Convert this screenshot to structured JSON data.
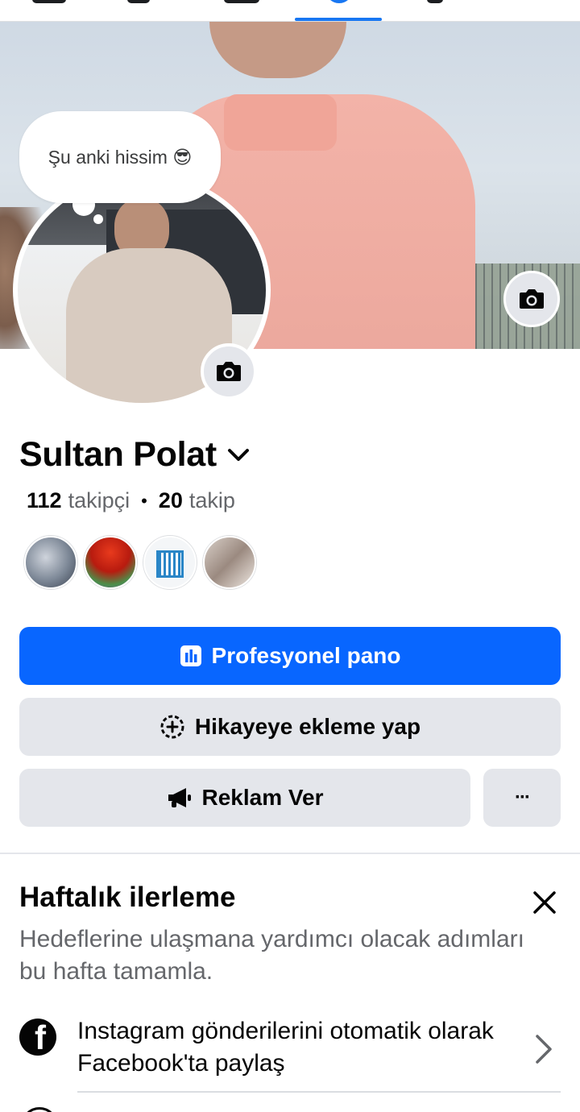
{
  "profile": {
    "note": "Şu anki hissim 😎",
    "name": "Sultan Polat",
    "followers_count": "112",
    "followers_label": "takipçi",
    "following_count": "20",
    "following_label": "takip"
  },
  "actions": {
    "dashboard": "Profesyonel pano",
    "add_story": "Hikayeye ekleme yap",
    "advertise": "Reklam Ver",
    "more": "···"
  },
  "weekly_progress": {
    "title": "Haftalık ilerleme",
    "description": "Hedeflerine ulaşmana yardımcı olacak adımları bu hafta tamamla.",
    "tasks": [
      {
        "icon": "facebook-icon",
        "label": "Instagram gönderilerini otomatik olarak Facebook'ta paylaş"
      }
    ]
  },
  "colors": {
    "primary": "#0866ff",
    "secondary_button": "#e4e6eb",
    "text": "#050505",
    "muted_text": "#65676b"
  }
}
